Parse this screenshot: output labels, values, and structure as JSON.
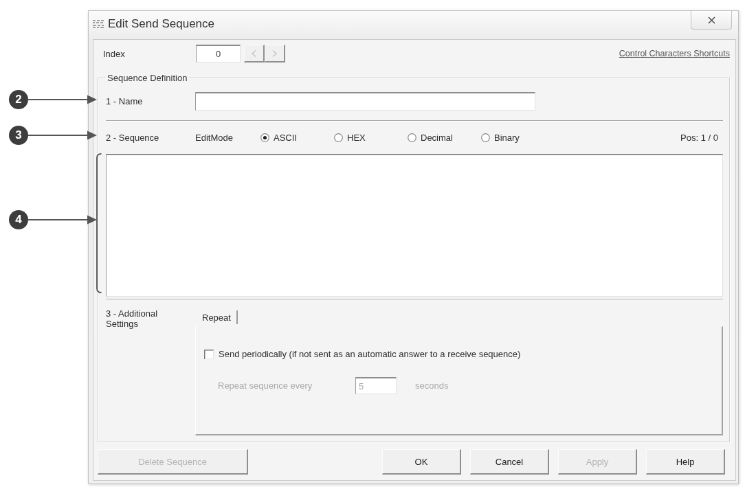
{
  "callouts": [
    {
      "number": "2",
      "bracket": false
    },
    {
      "number": "3",
      "bracket": false
    },
    {
      "number": "4",
      "bracket": true
    }
  ],
  "window": {
    "title": "Edit Send Sequence"
  },
  "index": {
    "label": "Index",
    "value": "0",
    "nav": [
      {
        "kind": "prev",
        "disabled": true
      },
      {
        "kind": "next",
        "disabled": true
      }
    ]
  },
  "shortcuts_link": "Control Characters Shortcuts",
  "sequence_definition": {
    "title": "Sequence Definition",
    "name": {
      "label": "1 - Name"
    },
    "sequence": {
      "label": "2 - Sequence",
      "edit_mode_label": "EditMode",
      "modes": [
        {
          "label": "ASCII",
          "selected": true
        },
        {
          "label": "HEX",
          "selected": false
        },
        {
          "label": "Decimal",
          "selected": false
        },
        {
          "label": "Binary",
          "selected": false
        }
      ],
      "position": "Pos: 1 / 0"
    },
    "additional_settings": {
      "label": "3 - Additional Settings",
      "tabs": [
        {
          "label": "Repeat",
          "selected": true
        }
      ],
      "send_periodically": {
        "label": "Send periodically (if not sent as an automatic answer to a receive sequence)",
        "checked": false
      },
      "repeat": {
        "label": "Repeat sequence every",
        "value": "5",
        "unit": "seconds",
        "disabled": true
      }
    }
  },
  "buttons": [
    {
      "label": "Delete Sequence",
      "disabled": true
    },
    {
      "label": "OK",
      "disabled": false
    },
    {
      "label": "Cancel",
      "disabled": false
    },
    {
      "label": "Apply",
      "disabled": true
    },
    {
      "label": "Help",
      "disabled": false
    }
  ]
}
